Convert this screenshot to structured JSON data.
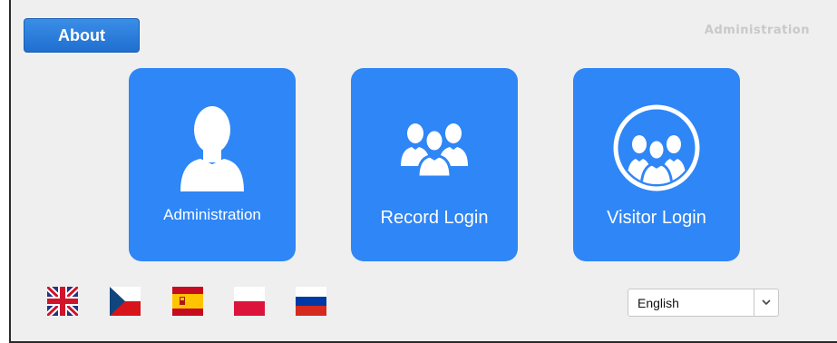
{
  "header": {
    "about_label": "About",
    "admin_link": "Administration"
  },
  "tiles": [
    {
      "label": "Administration",
      "icon": "admin-person-icon"
    },
    {
      "label": "Record Login",
      "icon": "group-icon"
    },
    {
      "label": "Visitor Login",
      "icon": "visitor-group-circle-icon"
    }
  ],
  "languages": {
    "flags": [
      "uk-flag-icon",
      "czech-flag-icon",
      "spain-flag-icon",
      "poland-flag-icon",
      "russia-flag-icon"
    ],
    "selected": "English"
  },
  "colors": {
    "tile": "#2f86f6",
    "button": "#1f6fd0",
    "background": "#efefef"
  }
}
